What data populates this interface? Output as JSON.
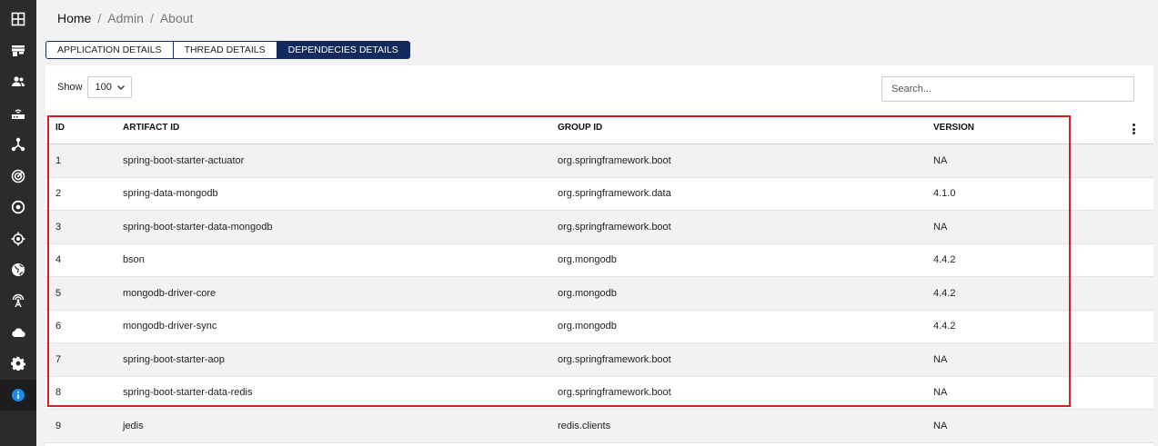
{
  "sidebar": {
    "items": [
      {
        "icon": "dashboard-icon"
      },
      {
        "icon": "store-icon"
      },
      {
        "icon": "users-icon"
      },
      {
        "icon": "router-icon"
      },
      {
        "icon": "hub-icon"
      },
      {
        "icon": "radar-icon"
      },
      {
        "icon": "target-icon"
      },
      {
        "icon": "crosshair-icon"
      },
      {
        "icon": "globe-icon"
      },
      {
        "icon": "antenna-icon"
      },
      {
        "icon": "cloud-icon"
      },
      {
        "icon": "gear-icon"
      },
      {
        "icon": "info-icon",
        "active": true
      }
    ],
    "active_color": "#1e88e5"
  },
  "breadcrumb": {
    "home": "Home",
    "separator": "/",
    "admin": "Admin",
    "current": "About"
  },
  "tabs": [
    {
      "label": "APPLICATION DETAILS",
      "active": false
    },
    {
      "label": "THREAD DETAILS",
      "active": false
    },
    {
      "label": "DEPENDECIES DETAILS",
      "active": true
    }
  ],
  "controls": {
    "show_label": "Show",
    "page_size": "100",
    "search_placeholder": "Search..."
  },
  "table": {
    "columns": [
      "ID",
      "ARTIFACT ID",
      "GROUP ID",
      "VERSION"
    ],
    "rows": [
      {
        "id": "1",
        "artifact": "spring-boot-starter-actuator",
        "group": "org.springframework.boot",
        "version": "NA"
      },
      {
        "id": "2",
        "artifact": "spring-data-mongodb",
        "group": "org.springframework.data",
        "version": "4.1.0"
      },
      {
        "id": "3",
        "artifact": "spring-boot-starter-data-mongodb",
        "group": "org.springframework.boot",
        "version": "NA"
      },
      {
        "id": "4",
        "artifact": "bson",
        "group": "org.mongodb",
        "version": "4.4.2"
      },
      {
        "id": "5",
        "artifact": "mongodb-driver-core",
        "group": "org.mongodb",
        "version": "4.4.2"
      },
      {
        "id": "6",
        "artifact": "mongodb-driver-sync",
        "group": "org.mongodb",
        "version": "4.4.2"
      },
      {
        "id": "7",
        "artifact": "spring-boot-starter-aop",
        "group": "org.springframework.boot",
        "version": "NA"
      },
      {
        "id": "8",
        "artifact": "spring-boot-starter-data-redis",
        "group": "org.springframework.boot",
        "version": "NA"
      },
      {
        "id": "9",
        "artifact": "jedis",
        "group": "redis.clients",
        "version": "NA"
      }
    ]
  },
  "colors": {
    "tab_active": "#132a5e",
    "highlight": "#e01b24",
    "sidebar": "#2b2b2b"
  }
}
